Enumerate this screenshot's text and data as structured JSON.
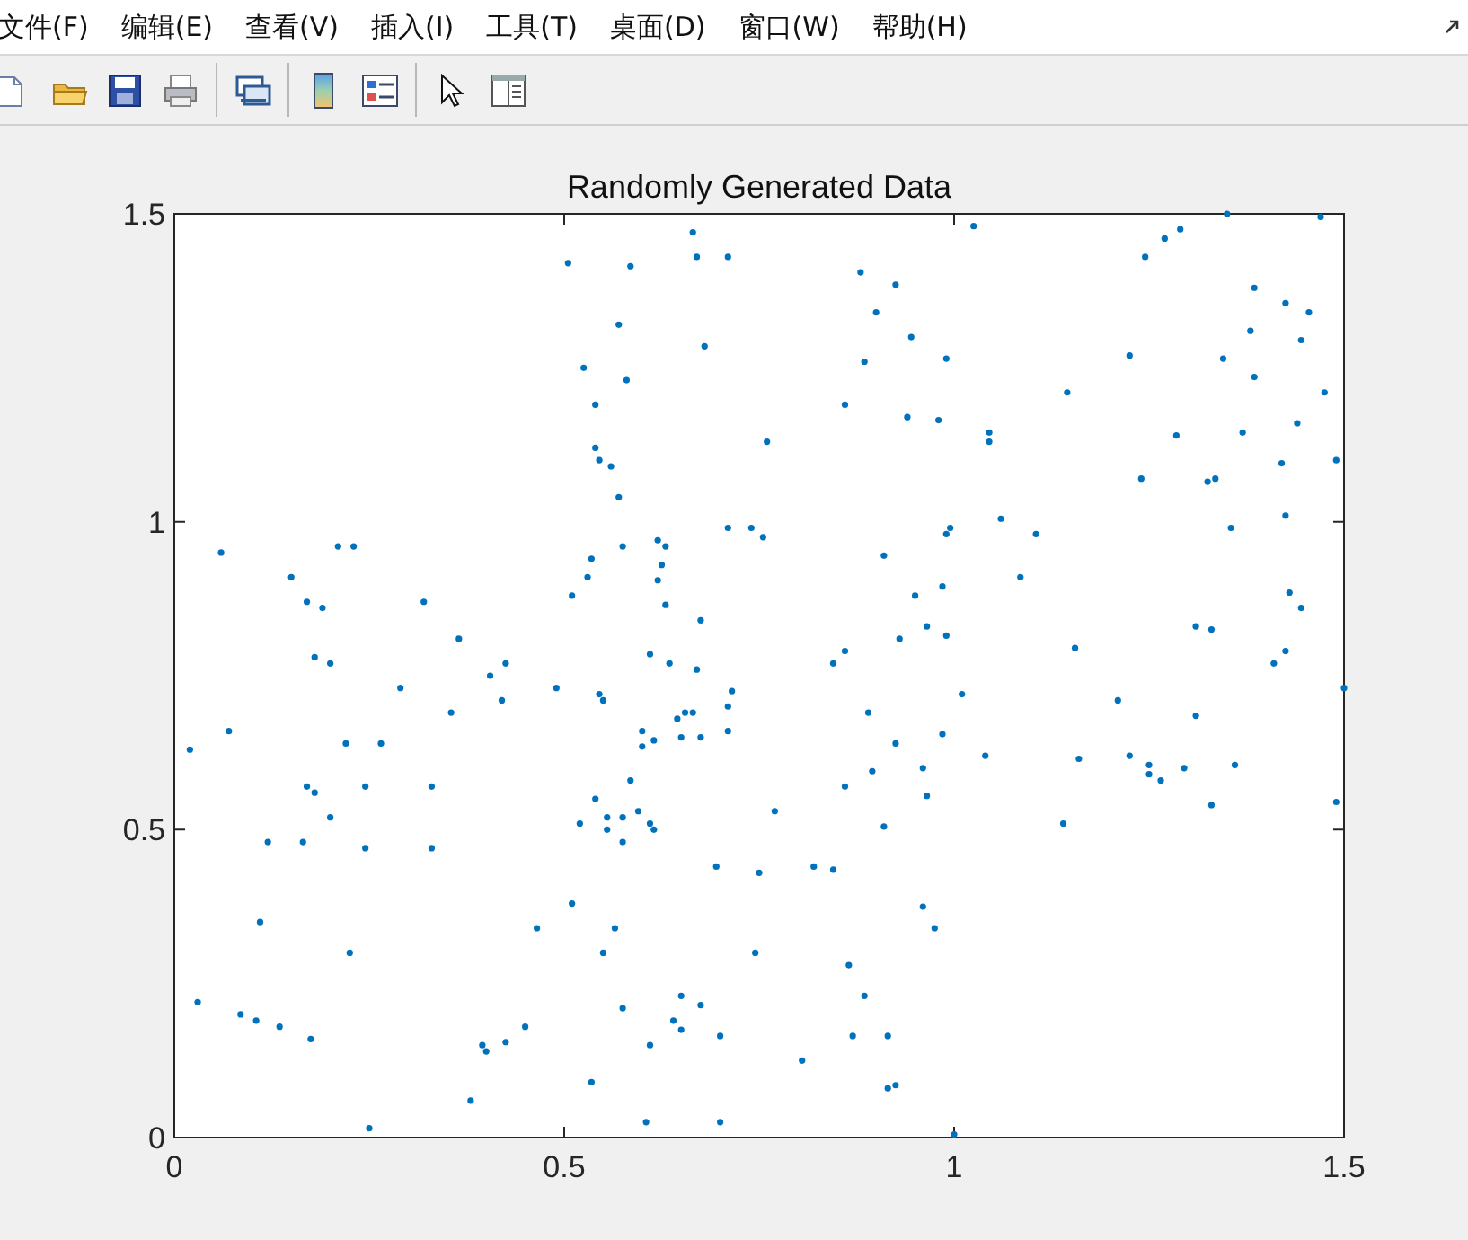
{
  "menu": [
    "文件(F)",
    "编辑(E)",
    "查看(V)",
    "插入(I)",
    "工具(T)",
    "桌面(D)",
    "窗口(W)",
    "帮助(H)"
  ],
  "figure": {
    "chart_data": {
      "type": "scatter",
      "title": "Randomly Generated Data",
      "xlim": [
        0,
        1.5
      ],
      "ylim": [
        0,
        1.5
      ],
      "xticks": [
        0,
        0.5,
        1,
        1.5
      ],
      "yticks": [
        0,
        0.5,
        1,
        1.5
      ],
      "x": [
        0.02,
        0.03,
        0.06,
        0.07,
        0.085,
        0.105,
        0.11,
        0.12,
        0.135,
        0.15,
        0.165,
        0.17,
        0.17,
        0.175,
        0.18,
        0.18,
        0.19,
        0.2,
        0.2,
        0.21,
        0.23,
        0.22,
        0.225,
        0.245,
        0.245,
        0.25,
        0.265,
        0.29,
        0.32,
        0.33,
        0.33,
        0.355,
        0.365,
        0.38,
        0.395,
        0.4,
        0.405,
        0.42,
        0.425,
        0.425,
        0.45,
        0.465,
        0.49,
        0.505,
        0.51,
        0.51,
        0.52,
        0.525,
        0.53,
        0.535,
        0.535,
        0.54,
        0.54,
        0.54,
        0.545,
        0.55,
        0.545,
        0.55,
        0.555,
        0.555,
        0.56,
        0.565,
        0.57,
        0.575,
        0.57,
        0.575,
        0.575,
        0.575,
        0.58,
        0.585,
        0.585,
        0.595,
        0.6,
        0.6,
        0.605,
        0.61,
        0.61,
        0.61,
        0.615,
        0.615,
        0.62,
        0.62,
        0.625,
        0.63,
        0.63,
        0.635,
        0.64,
        0.645,
        0.65,
        0.65,
        0.65,
        0.655,
        0.665,
        0.665,
        0.67,
        0.67,
        0.675,
        0.675,
        0.675,
        0.68,
        0.695,
        0.7,
        0.7,
        0.71,
        0.71,
        0.71,
        0.71,
        0.715,
        0.74,
        0.745,
        0.75,
        0.755,
        0.76,
        0.77,
        0.805,
        0.82,
        0.845,
        0.845,
        0.86,
        0.86,
        0.86,
        0.865,
        0.87,
        0.88,
        0.885,
        0.885,
        0.89,
        0.895,
        0.9,
        0.91,
        0.91,
        0.915,
        0.915,
        0.925,
        0.925,
        0.925,
        0.93,
        0.94,
        0.945,
        0.95,
        0.96,
        0.96,
        0.965,
        0.965,
        0.975,
        0.98,
        0.985,
        0.985,
        0.99,
        0.99,
        0.99,
        0.995,
        1.0,
        1.01,
        1.025,
        1.04,
        1.045,
        1.045,
        1.06,
        1.085,
        1.105,
        1.14,
        1.145,
        1.155,
        1.16,
        1.21,
        1.225,
        1.225,
        1.24,
        1.245,
        1.25,
        1.25,
        1.265,
        1.27,
        1.285,
        1.29,
        1.295,
        1.31,
        1.31,
        1.325,
        1.33,
        1.33,
        1.335,
        1.345,
        1.35,
        1.355,
        1.36,
        1.37,
        1.38,
        1.385,
        1.385,
        1.41,
        1.42,
        1.425,
        1.425,
        1.425,
        1.43,
        1.44,
        1.445,
        1.445,
        1.455,
        1.47,
        1.475,
        1.49,
        1.49,
        1.5
      ],
      "series": [
        {
          "color": "#0072bd",
          "values": [
            0.63,
            0.22,
            0.95,
            0.66,
            0.2,
            0.19,
            0.35,
            0.48,
            0.18,
            0.91,
            0.48,
            0.87,
            0.57,
            0.16,
            0.78,
            0.56,
            0.86,
            0.77,
            0.52,
            0.96,
            0.96,
            0.64,
            0.3,
            0.57,
            0.47,
            0.015,
            0.64,
            0.73,
            0.87,
            0.57,
            0.47,
            0.69,
            0.81,
            0.06,
            0.15,
            0.14,
            0.75,
            0.71,
            0.77,
            0.155,
            0.18,
            0.34,
            0.73,
            1.42,
            0.88,
            0.38,
            0.51,
            1.25,
            0.91,
            0.09,
            0.94,
            0.55,
            1.19,
            1.12,
            0.72,
            0.71,
            1.1,
            0.3,
            0.5,
            0.52,
            1.09,
            0.34,
            1.04,
            0.52,
            1.32,
            0.21,
            0.96,
            0.48,
            1.23,
            0.58,
            1.415,
            0.53,
            0.66,
            0.635,
            0.025,
            0.15,
            0.51,
            0.785,
            0.5,
            0.645,
            0.97,
            0.905,
            0.93,
            0.865,
            0.96,
            0.77,
            0.19,
            0.68,
            0.23,
            0.175,
            0.65,
            0.69,
            0.69,
            1.47,
            0.76,
            1.43,
            0.84,
            0.215,
            0.65,
            1.285,
            0.44,
            0.165,
            0.025,
            0.7,
            0.66,
            1.43,
            0.99,
            0.725,
            0.99,
            0.3,
            0.43,
            0.975,
            1.13,
            0.53,
            0.125,
            0.44,
            0.77,
            0.435,
            1.19,
            0.79,
            0.57,
            0.28,
            0.165,
            1.405,
            1.26,
            0.23,
            0.69,
            0.595,
            1.34,
            0.945,
            0.505,
            0.165,
            0.08,
            0.64,
            0.085,
            1.385,
            0.81,
            1.17,
            1.3,
            0.88,
            0.6,
            0.375,
            0.83,
            0.555,
            0.34,
            1.165,
            0.655,
            0.895,
            1.265,
            0.98,
            0.815,
            0.99,
            0.005,
            0.72,
            1.48,
            0.62,
            1.13,
            1.145,
            1.005,
            0.91,
            0.98,
            0.51,
            1.21,
            0.795,
            0.615,
            0.71,
            1.27,
            0.62,
            1.07,
            1.43,
            0.605,
            0.59,
            0.58,
            1.46,
            1.14,
            1.475,
            0.6,
            0.685,
            0.83,
            1.065,
            0.825,
            0.54,
            1.07,
            1.265,
            1.5,
            0.99,
            0.605,
            1.145,
            1.31,
            1.235,
            1.38,
            0.77,
            1.095,
            1.01,
            0.79,
            1.355,
            0.885,
            1.16,
            1.295,
            0.86,
            1.34,
            1.495,
            1.21,
            1.1,
            0.545,
            0.73
          ]
        }
      ]
    }
  }
}
